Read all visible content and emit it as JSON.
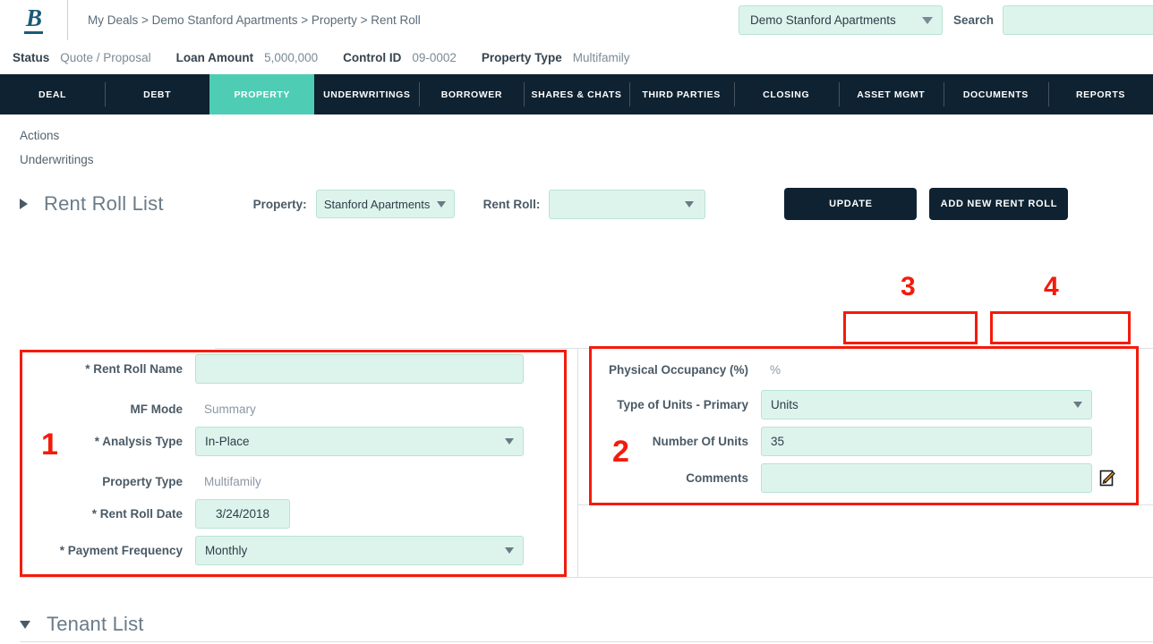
{
  "header": {
    "logo_text": "B",
    "breadcrumb": "My Deals > Demo Stanford Apartments > Property > Rent Roll",
    "deal_select_value": "Demo Stanford Apartments",
    "search_label": "Search",
    "search_value": "",
    "search_placeholder": ""
  },
  "status_bar": [
    {
      "key": "Status",
      "value": "Quote / Proposal"
    },
    {
      "key": "Loan Amount",
      "value": "5,000,000"
    },
    {
      "key": "Control ID",
      "value": "09-0002"
    },
    {
      "key": "Property Type",
      "value": "Multifamily"
    }
  ],
  "nav_tabs": [
    {
      "label": "DEAL",
      "active": false
    },
    {
      "label": "DEBT",
      "active": false
    },
    {
      "label": "PROPERTY",
      "active": true
    },
    {
      "label": "UNDERWRITINGS",
      "active": false
    },
    {
      "label": "BORROWER",
      "active": false
    },
    {
      "label": "SHARES & CHATS",
      "active": false
    },
    {
      "label": "THIRD PARTIES",
      "active": false
    },
    {
      "label": "CLOSING",
      "active": false
    },
    {
      "label": "ASSET MGMT",
      "active": false
    },
    {
      "label": "DOCUMENTS",
      "active": false
    },
    {
      "label": "REPORTS",
      "active": false
    }
  ],
  "sidelinks": {
    "actions": "Actions",
    "underwritings": "Underwritings"
  },
  "rent_roll_list": {
    "title": "Rent Roll List",
    "property_label": "Property:",
    "property_value": "Stanford Apartments",
    "rent_roll_label": "Rent Roll:",
    "rent_roll_value": "",
    "update_button": "UPDATE",
    "add_button": "ADD NEW RENT ROLL"
  },
  "left_form": {
    "rent_roll_name_label": "* Rent Roll Name",
    "rent_roll_name_value": "",
    "mf_mode_label": "MF Mode",
    "mf_mode_value": "Summary",
    "analysis_type_label": "* Analysis Type",
    "analysis_type_value": "In-Place",
    "property_type_label": "Property Type",
    "property_type_value": "Multifamily",
    "rent_roll_date_label": "* Rent Roll Date",
    "rent_roll_date_value": "3/24/2018",
    "payment_frequency_label": "* Payment Frequency",
    "payment_frequency_value": "Monthly"
  },
  "right_form": {
    "physical_occupancy_label": "Physical Occupancy (%)",
    "physical_occupancy_value": "%",
    "type_of_units_label": "Type of Units - Primary",
    "type_of_units_value": "Units",
    "number_of_units_label": "Number Of Units",
    "number_of_units_value": "35",
    "comments_label": "Comments",
    "comments_value": ""
  },
  "tenant_list": {
    "title": "Tenant List"
  },
  "annotations": [
    {
      "number": "1"
    },
    {
      "number": "2"
    },
    {
      "number": "3"
    },
    {
      "number": "4"
    }
  ],
  "colors": {
    "navbar": "#0f2231",
    "accent_teal": "#4ecdb4",
    "input_fill": "#ddf4ec",
    "input_border": "#b9e3d5",
    "annotation_red": "#f41b0c",
    "logo_blue": "#1b5a78"
  }
}
